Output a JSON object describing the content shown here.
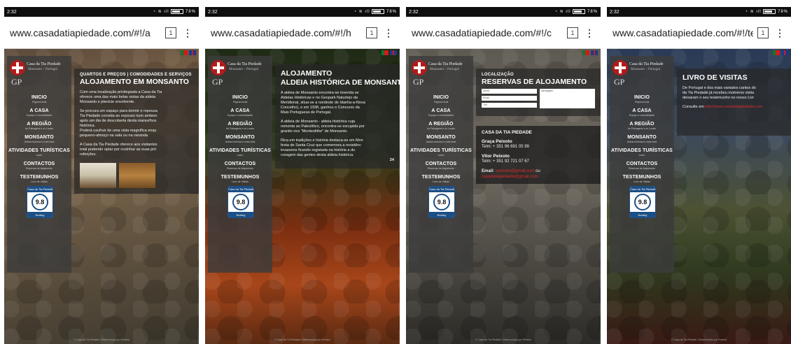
{
  "common": {
    "time": "2:32",
    "battery": "78%",
    "tab_count": "1",
    "logo": {
      "name": "Casa da Tia Piedade",
      "location": "Monsanto – Portugal",
      "initials": "GP"
    },
    "nav": [
      {
        "label": "INICIO",
        "sub": "Página inicial"
      },
      {
        "label": "A CASA",
        "sub": "Espaço e comodidades"
      },
      {
        "label": "A REGIÃO",
        "sub": "As Paisagens e os Locais"
      },
      {
        "label": "MONSANTO",
        "sub": "Aldeia histórica e mais bela"
      },
      {
        "label": "ATIVIDADES TURÍSTICAS",
        "sub": "Lazer"
      },
      {
        "label": "CONTACTOS",
        "sub": "Reservas de Alojamento"
      },
      {
        "label": "TESTEMUNHOS",
        "sub": "Livro de Visitas"
      }
    ],
    "badge": {
      "top": "Casa da Tia Piedade",
      "score": "9.8",
      "bottom": "Booking"
    },
    "footer": "© Casa da Tia Piedade | Desenvolvido por Ferreira"
  },
  "screens": [
    {
      "url": "www.casadatiapiedade.com/#!/a",
      "kicker": "QUARTOS E PREÇOS | COMODIDADES E SERVIÇOS",
      "title": "ALOJAMENTO EM MONSANTO",
      "lines": [
        "Com uma localização privilegiada a Casa da Tia",
        "oferece uma das mais belas vistas da aldeia",
        "Monsanto e planície envolvente.",
        "",
        "Se procura um espaço para dormir e repousa",
        "Tia Piedade convida ao repouso num ambien",
        "após um dia de descoberta desta maravilhos",
        "histórica.",
        "Poderá usufruir de uma vista magnífica enqu",
        "pequeno-almoço na sala ou na varanda.",
        "",
        "A Casa da Tia Piedade oferece aos visitantes",
        "total podendo optar por cozinhar as suas pró",
        "refeições."
      ]
    },
    {
      "url": "www.casadatiapiedade.com/#!/h",
      "kicker": "",
      "title": "ALOJAMENTO",
      "title2": "ALDEIA HISTÓRICA DE MONSANTO",
      "lines": [
        "A aldeia de Monsanto encontra-se inserida se",
        "Aldeias Históricas e no Geopark Naturtejo da",
        "Meridional, situa-se a nordeste de Idanha-a-Nova",
        "Concelho), e em 1938, ganhou o Concurso da",
        "Mais Portuguesa de Portugal.",
        "",
        "A aldeia de Monsanto - aldeia histórica cuja",
        "remonta ao Paleolítico, encontra-se escupida por",
        "granito nos \"Monteolithe\" de Monsanto.",
        "",
        "Rica em tradições e história destaca-se em Mon",
        "festa de Santa Cruz que comemora a resistênc",
        "invasores ficando registada na história a du",
        "coragem das gentes desta aldeia histórica."
      ],
      "page": "24"
    },
    {
      "url": "www.casadatiapiedade.com/#!/c",
      "kicker": "LOCALIZAÇÃO",
      "title": "RESERVAS DE ALOJAMENTO",
      "form": {
        "name": "Nome",
        "email": "Email",
        "phone": "Tlm",
        "message": "Mensagem"
      },
      "contact": {
        "heading": "CASA DA TIA PIEDADE",
        "p1_name": "Graça Peixoto",
        "p1_phone": "Telm: + 351 96 691 05 99",
        "p2_name": "Vitor Peixoto",
        "p2_phone": "Telm: + 351 92 721 07 67",
        "email_label": "Email:",
        "email1": "vpeixoto@gmail.com",
        "email_or": "ou",
        "email2": "casadatiapiedade@gmail.com"
      }
    },
    {
      "url": "www.casadatiapiedade.com/#!/te",
      "kicker": "",
      "title": "LIVRO DE VISITAS",
      "lines": [
        "De Portugal e dos mais variados cantos do",
        "da Tia Piedade já recebeu inúmeros visita",
        "deixaram o seu testemunho no nosso Livr"
      ],
      "consult_prefix": "Consulte em",
      "consult_link": "http://www.casadatiapiedade.com"
    }
  ]
}
